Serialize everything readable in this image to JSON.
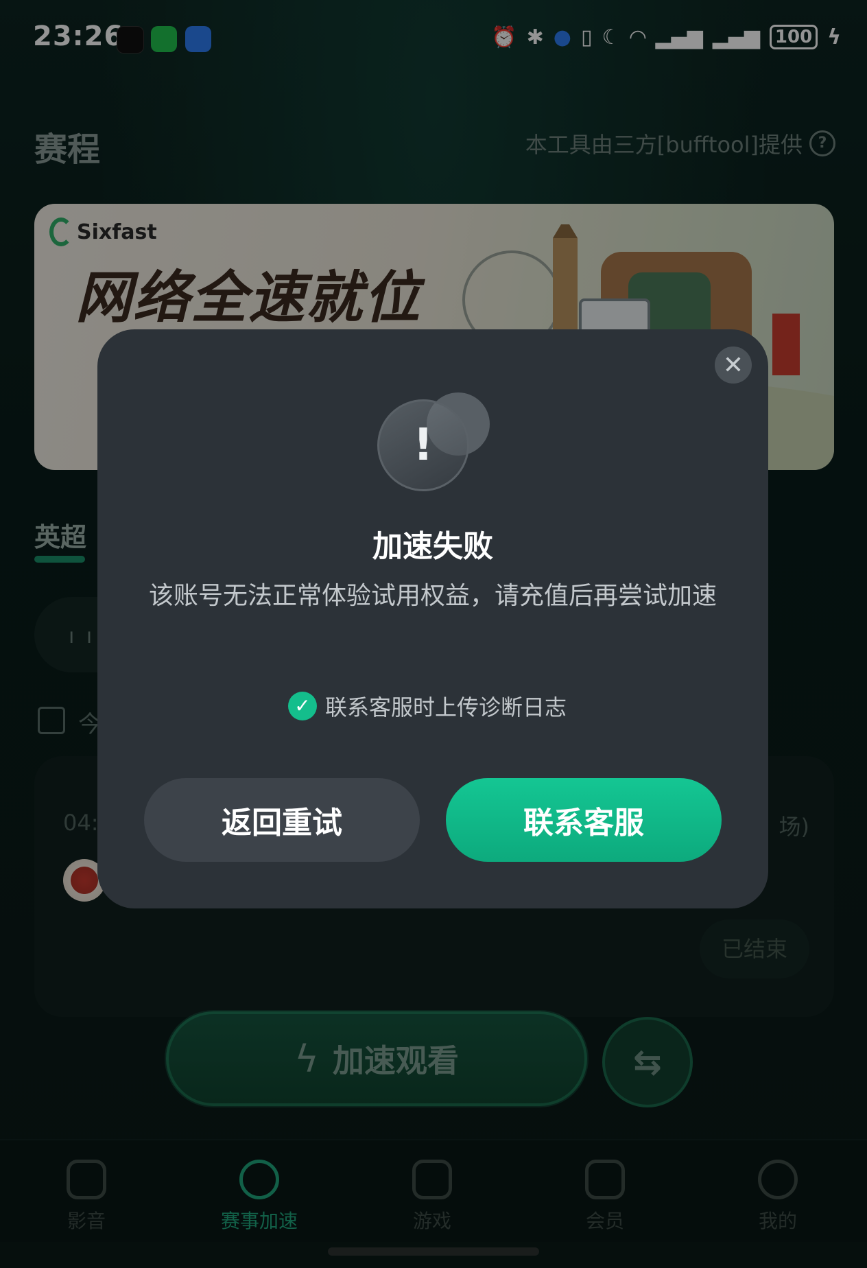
{
  "status_bar": {
    "time": "23:26",
    "battery": "100"
  },
  "header": {
    "title": "赛程",
    "provider": "本工具由三方[bufftool]提供",
    "help_symbol": "?"
  },
  "banner": {
    "brand": "Sixfast",
    "slogan": "网络全速就位"
  },
  "league_tab": {
    "label": "英超"
  },
  "date_filter": {
    "text": "今"
  },
  "match": {
    "time": "04:",
    "venue": "场)",
    "status": "已结束"
  },
  "boost_button": {
    "label": "加速观看"
  },
  "bottom_nav": [
    {
      "label": "影音",
      "icon": "tv-icon"
    },
    {
      "label": "赛事加速",
      "icon": "football-icon",
      "active": true
    },
    {
      "label": "游戏",
      "icon": "gamepad-icon"
    },
    {
      "label": "会员",
      "icon": "crown-icon"
    },
    {
      "label": "我的",
      "icon": "profile-icon"
    }
  ],
  "dialog": {
    "title": "加速失败",
    "message": "该账号无法正常体验试用权益，请充值后再尝试加速",
    "checkbox_label": "联系客服时上传诊断日志",
    "checkbox_checked": true,
    "retry_label": "返回重试",
    "contact_label": "联系客服"
  },
  "colors": {
    "accent": "#14be8c",
    "dialog_bg": "#2c3238",
    "page_bg": "#0b1c1a"
  }
}
